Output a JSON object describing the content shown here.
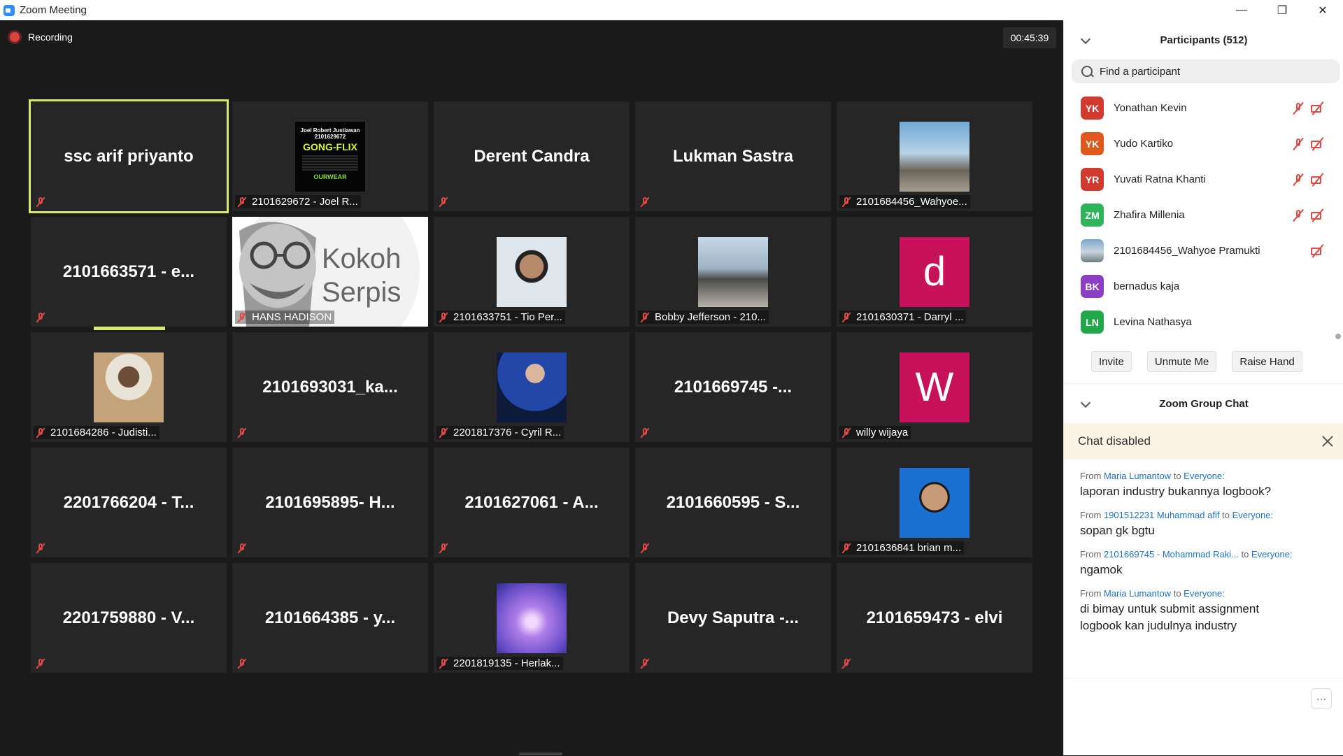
{
  "window": {
    "title": "Zoom Meeting",
    "min": "—",
    "restore": "❐",
    "close": "✕"
  },
  "recording": {
    "label": "Recording"
  },
  "timer": "00:45:39",
  "tiles": [
    {
      "big": "ssc arif priyanto",
      "label": "",
      "photo": "",
      "active": true
    },
    {
      "big": "",
      "label": "2101629672 - Joel R...",
      "photo": "poster"
    },
    {
      "big": "Derent Candra",
      "label": "",
      "photo": ""
    },
    {
      "big": "Lukman Sastra",
      "label": "",
      "photo": ""
    },
    {
      "big": "",
      "label": "2101684456_Wahyoe...",
      "photo": "beach"
    },
    {
      "big": "2101663571 - e...",
      "label": "",
      "photo": ""
    },
    {
      "big": "",
      "label": "HANS HADISON",
      "photo": "kokoh"
    },
    {
      "big": "",
      "label": "2101633751 - Tio Per...",
      "photo": "person1"
    },
    {
      "big": "",
      "label": "Bobby Jefferson - 210...",
      "photo": "city"
    },
    {
      "big": "",
      "label": "2101630371 - Darryl ...",
      "photo": "d"
    },
    {
      "big": "",
      "label": "2101684286 - Judisti...",
      "photo": "person2"
    },
    {
      "big": "2101693031_ka...",
      "label": "",
      "photo": ""
    },
    {
      "big": "",
      "label": "2201817376 - Cyril R...",
      "photo": "person3"
    },
    {
      "big": "2101669745 -...",
      "label": "",
      "photo": ""
    },
    {
      "big": "",
      "label": "willy wijaya",
      "photo": "w"
    },
    {
      "big": "2201766204 - T...",
      "label": "",
      "photo": ""
    },
    {
      "big": "2101695895- H...",
      "label": "",
      "photo": ""
    },
    {
      "big": "2101627061 - A...",
      "label": "",
      "photo": ""
    },
    {
      "big": "2101660595 - S...",
      "label": "",
      "photo": ""
    },
    {
      "big": "",
      "label": "2101636841 brian m...",
      "photo": "idphoto"
    },
    {
      "big": "2201759880 - V...",
      "label": "",
      "photo": ""
    },
    {
      "big": "2101664385 - y...",
      "label": "",
      "photo": ""
    },
    {
      "big": "",
      "label": "2201819135 - Herlak...",
      "photo": "purple"
    },
    {
      "big": "Devy Saputra -...",
      "label": "",
      "photo": ""
    },
    {
      "big": "2101659473 - elvi",
      "label": "",
      "photo": ""
    }
  ],
  "poster": {
    "line1": "Joel Robert Justiawan",
    "line2": "2101629672",
    "brand": "GONG-FLIX",
    "sub": "OURWEAR"
  },
  "kokoh": {
    "line1": "Kokoh",
    "line2": "Serpis"
  },
  "letters": {
    "d": "d",
    "w": "W"
  },
  "participants": {
    "header": "Participants (512)",
    "search_placeholder": "Find a participant",
    "list": [
      {
        "initials": "YK",
        "name": "Yonathan Kevin",
        "color": "#d13a2f",
        "mic": true,
        "cam": true
      },
      {
        "initials": "YK",
        "name": "Yudo Kartiko",
        "color": "#e0581c",
        "mic": true,
        "cam": true
      },
      {
        "initials": "YR",
        "name": "Yuvati Ratna Khanti",
        "color": "#d13a2f",
        "mic": true,
        "cam": true
      },
      {
        "initials": "ZM",
        "name": "Zhafira Millenia",
        "color": "#2fb35b",
        "mic": true,
        "cam": true
      },
      {
        "initials": "",
        "name": "2101684456_Wahyoe Pramukti",
        "color": "",
        "mic": false,
        "cam": true
      },
      {
        "initials": "BK",
        "name": "bernadus kaja",
        "color": "#8a3fc4",
        "mic": false,
        "cam": false
      },
      {
        "initials": "LN",
        "name": "Levina Nathasya",
        "color": "#22a84a",
        "mic": false,
        "cam": false
      }
    ],
    "buttons": {
      "invite": "Invite",
      "unmute": "Unmute Me",
      "raise": "Raise Hand"
    }
  },
  "chat": {
    "header": "Zoom Group Chat",
    "banner": "Chat disabled",
    "messages": [
      {
        "from_word": "From",
        "sender": "Maria Lumantow",
        "to_word": "to",
        "target": "Everyone:",
        "text": "laporan industry bukannya logbook?"
      },
      {
        "from_word": "From",
        "sender": "1901512231 Muhammad afif",
        "to_word": "to",
        "target": "Everyone:",
        "text": "sopan gk bgtu"
      },
      {
        "from_word": "From",
        "sender": "2101669745 - Mohammad Raki...",
        "to_word": "to",
        "target": "Everyone:",
        "text": "ngamok"
      },
      {
        "from_word": "From",
        "sender": "Maria Lumantow",
        "to_word": "to",
        "target": "Everyone:",
        "text": "di bimay untuk submit assignment logbook kan judulnya industry"
      }
    ],
    "more": "···"
  },
  "colors": {
    "accent": "#d7e86a",
    "muted_red": "#e04a44",
    "link_blue": "#1a73c8"
  }
}
